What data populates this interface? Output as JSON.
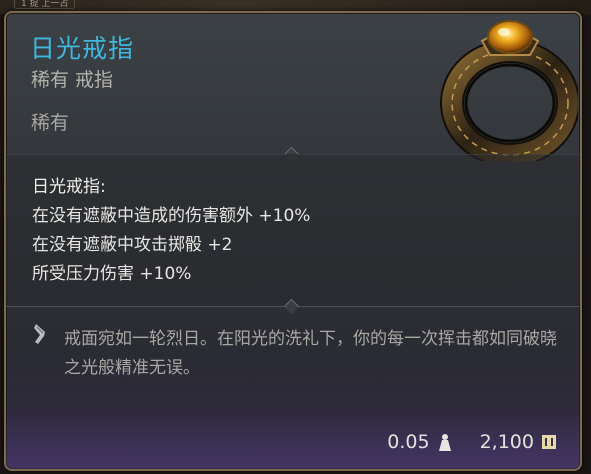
{
  "background": {
    "chip_text": "1 提  上一占"
  },
  "tooltip": {
    "title": "日光戒指",
    "subtitle": "稀有 戒指",
    "rarity": "稀有",
    "item_icon": "ring-icon",
    "effects": {
      "heading": "日光戒指:",
      "lines": [
        "在没有遮蔽中造成的伤害额外 +10%",
        "在没有遮蔽中攻击掷骰 +2",
        "所受压力伤害 +10%"
      ]
    },
    "flavor": {
      "icon": "quill-icon",
      "text": "戒面宛如一轮烈日。在阳光的洗礼下，你的每一次挥击都如同破晓之光般精准无误。"
    },
    "footer": {
      "weight": "0.05",
      "weight_icon": "weight-icon",
      "value": "2,100",
      "value_icon": "coin-icon"
    }
  },
  "colors": {
    "title": "#3fb8e0",
    "border": "#7d6a50",
    "footer_tint": "#3c3157"
  }
}
